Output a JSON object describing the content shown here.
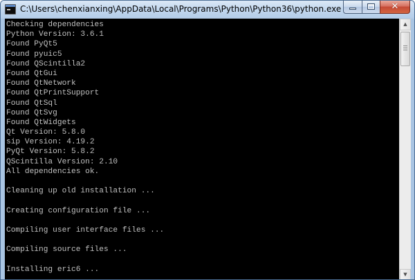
{
  "window": {
    "title": "C:\\Users\\chenxianxing\\AppData\\Local\\Programs\\Python\\Python36\\python.exe",
    "icon": "console-app-icon",
    "buttons": {
      "minimize_icon": "minimize-icon",
      "maximize_icon": "maximize-icon",
      "close_glyph": "✕"
    }
  },
  "console": {
    "background": "#000000",
    "text_color": "#c0c0c0",
    "lines": [
      "Checking dependencies",
      "Python Version: 3.6.1",
      "Found PyQt5",
      "Found pyuic5",
      "Found QScintilla2",
      "Found QtGui",
      "Found QtNetwork",
      "Found QtPrintSupport",
      "Found QtSql",
      "Found QtSvg",
      "Found QtWidgets",
      "Qt Version: 5.8.0",
      "sip Version: 4.19.2",
      "PyQt Version: 5.8.2",
      "QScintilla Version: 2.10",
      "All dependencies ok.",
      "",
      "Cleaning up old installation ...",
      "",
      "Creating configuration file ...",
      "",
      "Compiling user interface files ...",
      "",
      "Compiling source files ...",
      "",
      "Installing eric6 ..."
    ]
  },
  "scrollbar": {
    "up_glyph": "▲",
    "down_glyph": "▼"
  },
  "colors": {
    "frame": "#b9d1ea",
    "close_button": "#c44a36"
  }
}
